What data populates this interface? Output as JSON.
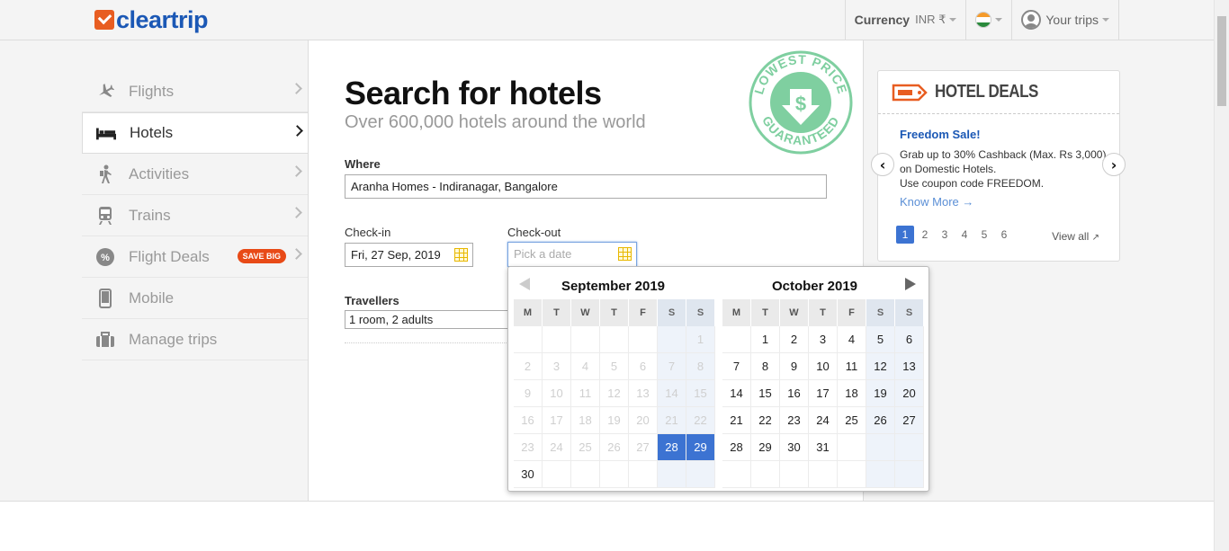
{
  "header": {
    "logo_text": "cleartrip",
    "currency_label": "Currency",
    "currency_value": "INR ₹",
    "your_trips": "Your trips"
  },
  "sidebar": {
    "items": [
      {
        "label": "Flights",
        "icon": "plane-icon",
        "glyph": "✈"
      },
      {
        "label": "Hotels",
        "icon": "bed-icon",
        "glyph": "🛏"
      },
      {
        "label": "Activities",
        "icon": "hiker-icon",
        "glyph": "🚶"
      },
      {
        "label": "Trains",
        "icon": "train-icon",
        "glyph": "🚆"
      },
      {
        "label": "Flight Deals",
        "icon": "percent-badge-icon",
        "glyph": "%",
        "badge": "SAVE BIG"
      },
      {
        "label": "Mobile",
        "icon": "mobile-icon",
        "glyph": "▯"
      },
      {
        "label": "Manage trips",
        "icon": "suitcase-icon",
        "glyph": "💼"
      }
    ]
  },
  "main": {
    "title": "Search for hotels",
    "subtitle": "Over 600,000 hotels around the world",
    "where_label": "Where",
    "where_value": "Aranha Homes - Indiranagar, Bangalore",
    "checkin_label": "Check-in",
    "checkin_value": "Fri, 27 Sep, 2019",
    "checkout_label": "Check-out",
    "checkout_placeholder": "Pick a date",
    "travellers_label": "Travellers",
    "travellers_value": "1 room, 2 adults",
    "stamp_top": "LOWEST PRICE",
    "stamp_bottom": "GUARANTEED"
  },
  "deals": {
    "title": "HOTEL DEALS",
    "deal_title": "Freedom Sale!",
    "deal_text": "Grab up to 30% Cashback (Max. Rs 3,000) on Domestic Hotels.",
    "deal_code": "Use coupon code FREEDOM.",
    "know_more": "Know More →",
    "pages": [
      "1",
      "2",
      "3",
      "4",
      "5",
      "6"
    ],
    "active_page": "1",
    "view_all": "View all"
  },
  "calendar": {
    "weekdays": [
      "M",
      "T",
      "W",
      "T",
      "F",
      "S",
      "S"
    ],
    "months": [
      {
        "title": "September 2019",
        "rows": [
          [
            "",
            "",
            "",
            "",
            "",
            "",
            "1"
          ],
          [
            "2",
            "3",
            "4",
            "5",
            "6",
            "7",
            "8"
          ],
          [
            "9",
            "10",
            "11",
            "12",
            "13",
            "14",
            "15"
          ],
          [
            "16",
            "17",
            "18",
            "19",
            "20",
            "21",
            "22"
          ],
          [
            "23",
            "24",
            "25",
            "26",
            "27",
            "28",
            "29"
          ],
          [
            "30",
            "",
            "",
            "",
            "",
            "",
            ""
          ]
        ],
        "past_through": 27,
        "selected": [
          "28",
          "29"
        ]
      },
      {
        "title": "October 2019",
        "rows": [
          [
            "",
            "1",
            "2",
            "3",
            "4",
            "5",
            "6"
          ],
          [
            "7",
            "8",
            "9",
            "10",
            "11",
            "12",
            "13"
          ],
          [
            "14",
            "15",
            "16",
            "17",
            "18",
            "19",
            "20"
          ],
          [
            "21",
            "22",
            "23",
            "24",
            "25",
            "26",
            "27"
          ],
          [
            "28",
            "29",
            "30",
            "31",
            "",
            "",
            ""
          ],
          [
            "",
            "",
            "",
            "",
            "",
            "",
            ""
          ]
        ],
        "past_through": 0,
        "selected": []
      }
    ]
  },
  "colors": {
    "brand_blue": "#1b58b5",
    "brand_orange": "#e85d21",
    "selected_date": "#3c73d2",
    "stamp_green": "#7fcfa0"
  }
}
